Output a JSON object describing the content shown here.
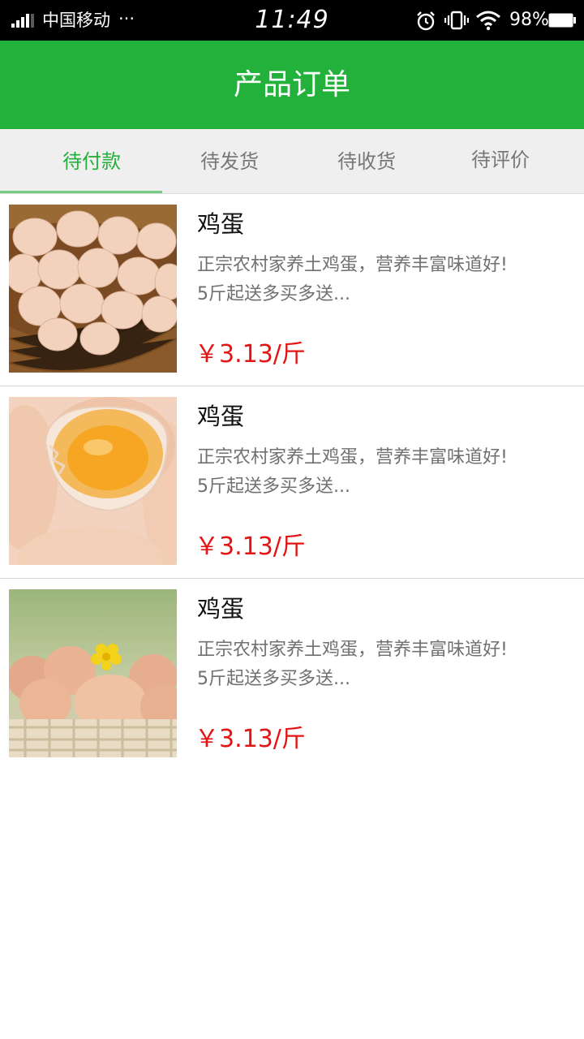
{
  "status_bar": {
    "carrier": "中国移动",
    "more": "···",
    "time": "11:49",
    "battery_percent": "98%",
    "icons": [
      "signal-icon",
      "alarm-icon",
      "vibrate-icon",
      "wifi-icon",
      "battery-icon"
    ]
  },
  "header": {
    "title": "产品订单",
    "background": "#22b13a"
  },
  "tabs": [
    {
      "label": "待付款",
      "active": true
    },
    {
      "label": "待发货",
      "active": false
    },
    {
      "label": "待收货",
      "active": false
    },
    {
      "label": "待评价",
      "active": false
    }
  ],
  "orders": [
    {
      "title": "鸡蛋",
      "desc_line1": "正宗农村家养土鸡蛋，营养丰富味道好!",
      "desc_line2": "5斤起送多买多送...",
      "price": "￥3.13/斤",
      "image": "eggs-in-basket"
    },
    {
      "title": "鸡蛋",
      "desc_line1": "正宗农村家养土鸡蛋，营养丰富味道好!",
      "desc_line2": "5斤起送多买多送...",
      "price": "￥3.13/斤",
      "image": "cracked-egg-yolk"
    },
    {
      "title": "鸡蛋",
      "desc_line1": "正宗农村家养土鸡蛋，营养丰富味道好!",
      "desc_line2": "5斤起送多买多送...",
      "price": "￥3.13/斤",
      "image": "eggs-with-flower"
    }
  ],
  "colors": {
    "accent": "#22b13a",
    "price": "#e31414"
  }
}
